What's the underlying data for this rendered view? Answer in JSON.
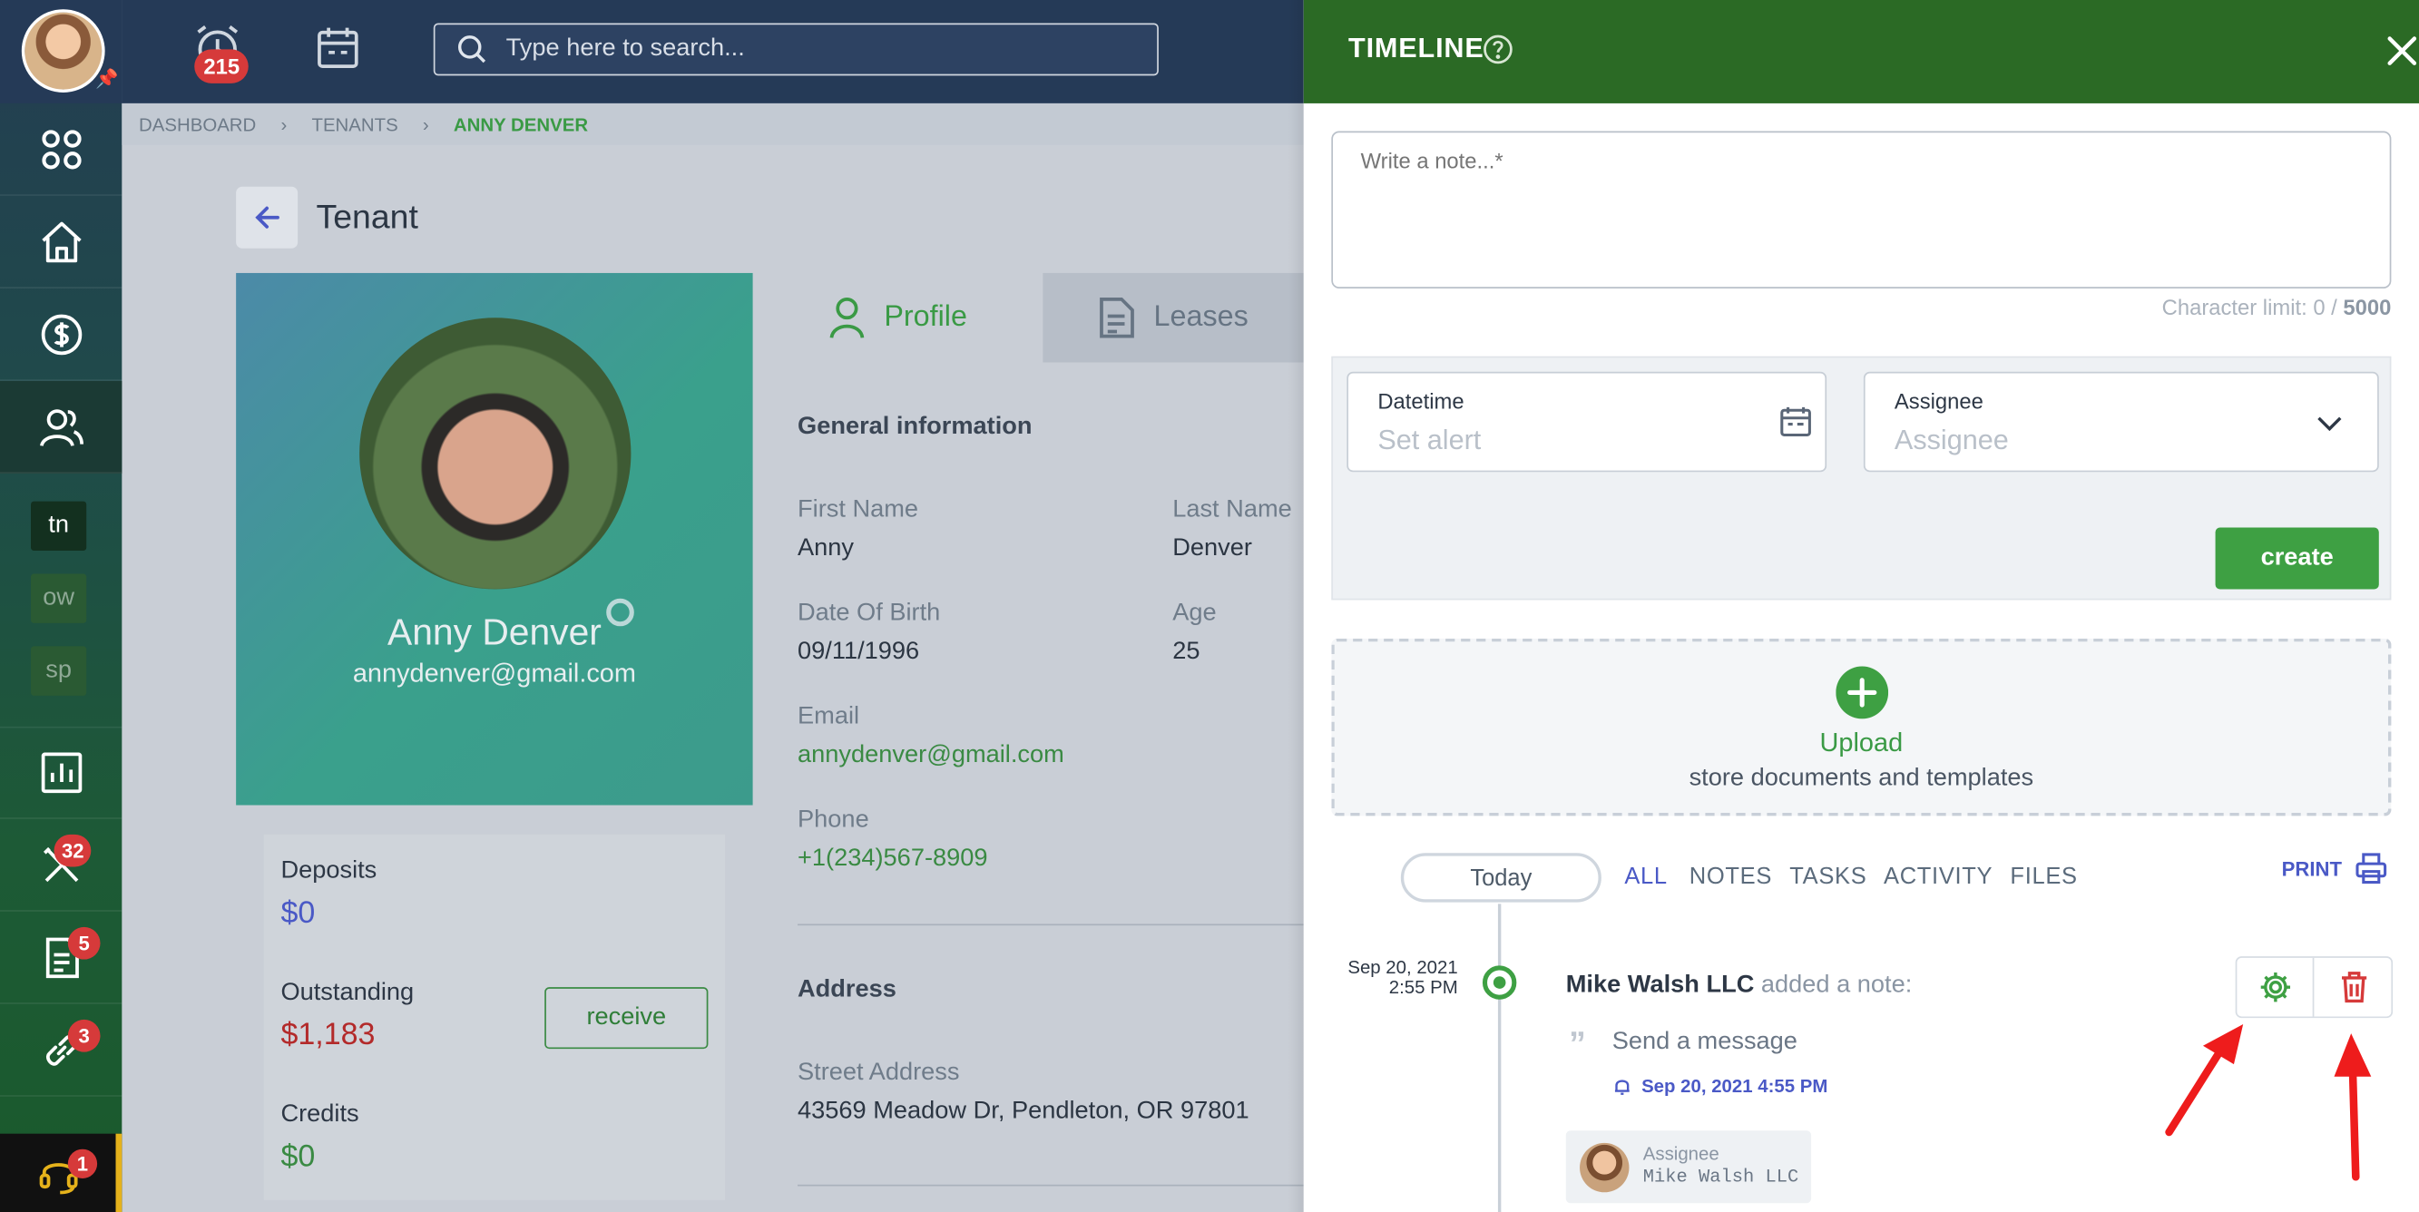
{
  "topbar": {
    "alarm_count": "215",
    "search_placeholder": "Type here to search..."
  },
  "sidebar": {
    "workspaces": [
      "tn",
      "ow",
      "sp"
    ],
    "badges": {
      "maintenance": "32",
      "documents": "5",
      "links": "3",
      "support": "1"
    }
  },
  "breadcrumb": {
    "items": [
      "DASHBOARD",
      "TENANTS",
      "ANNY DENVER"
    ]
  },
  "page": {
    "title": "Tenant"
  },
  "profile_card": {
    "name": "Anny Denver",
    "email": "annydenver@gmail.com"
  },
  "balances": {
    "deposits_label": "Deposits",
    "deposits_value": "$0",
    "outstanding_label": "Outstanding",
    "outstanding_value": "$1,183",
    "credits_label": "Credits",
    "credits_value": "$0",
    "receive_label": "receive"
  },
  "tabs": {
    "profile": "Profile",
    "leases": "Leases"
  },
  "general": {
    "heading": "General information",
    "first_name_label": "First Name",
    "first_name": "Anny",
    "last_name_label": "Last Name",
    "last_name": "Denver",
    "dob_label": "Date Of Birth",
    "dob": "09/11/1996",
    "age_label": "Age",
    "age": "25",
    "email_label": "Email",
    "email": "annydenver@gmail.com",
    "phone_label": "Phone",
    "phone": "+1(234)567-8909"
  },
  "address": {
    "heading": "Address",
    "street_label": "Street Address",
    "street": "43569 Meadow Dr, Pendleton, OR 97801"
  },
  "timeline": {
    "title": "TIMELINE",
    "note_placeholder": "Write a note...*",
    "char_limit_label": "Character limit: 0 / ",
    "char_limit_max": "5000",
    "datetime_label": "Datetime",
    "datetime_placeholder": "Set alert",
    "assignee_label": "Assignee",
    "assignee_placeholder": "Assignee",
    "create_label": "create",
    "upload_title": "Upload",
    "upload_sub": "store documents and templates",
    "today": "Today",
    "filters": [
      "ALL",
      "NOTES",
      "TASKS",
      "ACTIVITY",
      "FILES"
    ],
    "print": "PRINT",
    "entry": {
      "date": "Sep 20, 2021",
      "time": "2:55 PM",
      "author": "Mike Walsh LLC",
      "action": " added a note:",
      "body": "Send a message",
      "alert": "Sep 20, 2021 4:55 PM",
      "assignee_label": "Assignee",
      "assignee": "Mike Walsh LLC"
    }
  },
  "colors": {
    "accent_green": "#3ea043",
    "header_green": "#2b6a25",
    "danger": "#d63a3a",
    "link_blue": "#4a59c6"
  }
}
